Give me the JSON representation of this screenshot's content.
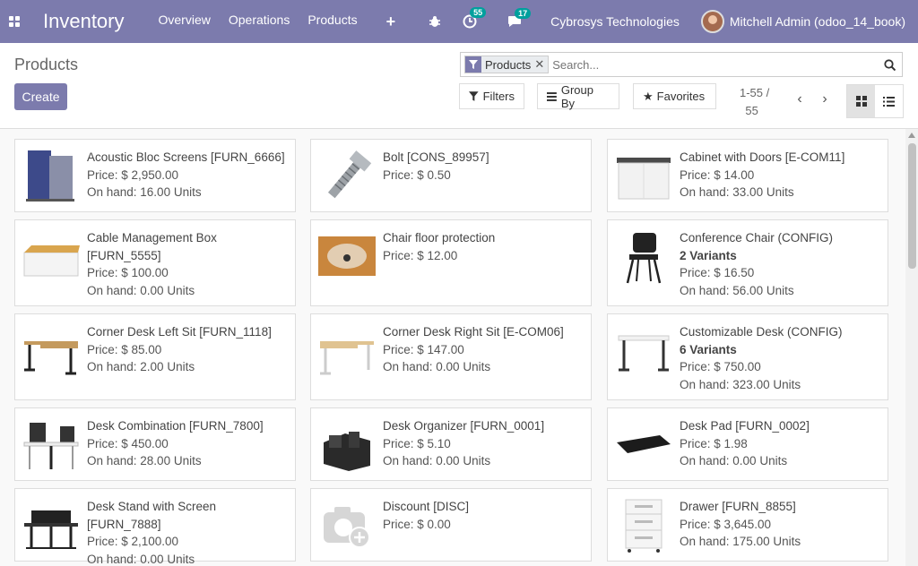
{
  "navbar": {
    "app_name": "Inventory",
    "menu": [
      "Overview",
      "Operations",
      "Products"
    ],
    "plus": "+",
    "activity_badge": "55",
    "messages_badge": "17",
    "company": "Cybrosys Technologies",
    "user": "Mitchell Admin (odoo_14_book)"
  },
  "control": {
    "breadcrumb": "Products",
    "create_label": "Create",
    "facet_label": "Products",
    "search_placeholder": "Search...",
    "filters_label": "Filters",
    "groupby_label": "Group By",
    "favorites_label": "Favorites",
    "pager_range": "1-55 /",
    "pager_total": "55"
  },
  "products": [
    {
      "name": "Acoustic Bloc Screens [FURN_6666]",
      "price": "Price: $ 2,950.00",
      "onhand": "On hand: 16.00 Units",
      "variants": "",
      "icon": "acoustic-screen"
    },
    {
      "name": "Bolt [CONS_89957]",
      "price": "Price: $ 0.50",
      "onhand": "",
      "variants": "",
      "icon": "bolt"
    },
    {
      "name": "Cabinet with Doors [E-COM11]",
      "price": "Price: $ 14.00",
      "onhand": "On hand: 33.00 Units",
      "variants": "",
      "icon": "cabinet"
    },
    {
      "name": "Cable Management Box [FURN_5555]",
      "price": "Price: $ 100.00",
      "onhand": "On hand: 0.00 Units",
      "variants": "",
      "icon": "cable-box"
    },
    {
      "name": "Chair floor protection",
      "price": "Price: $ 12.00",
      "onhand": "",
      "variants": "",
      "icon": "floor-mat"
    },
    {
      "name": "Conference Chair (CONFIG)",
      "price": "Price: $ 16.50",
      "onhand": "On hand: 56.00 Units",
      "variants": "2 Variants",
      "icon": "chair"
    },
    {
      "name": "Corner Desk Left Sit [FURN_1118]",
      "price": "Price: $ 85.00",
      "onhand": "On hand: 2.00 Units",
      "variants": "",
      "icon": "desk-left"
    },
    {
      "name": "Corner Desk Right Sit [E-COM06]",
      "price": "Price: $ 147.00",
      "onhand": "On hand: 0.00 Units",
      "variants": "",
      "icon": "desk-right"
    },
    {
      "name": "Customizable Desk (CONFIG)",
      "price": "Price: $ 750.00",
      "onhand": "On hand: 323.00 Units",
      "variants": "6 Variants",
      "icon": "desk-custom"
    },
    {
      "name": "Desk Combination [FURN_7800]",
      "price": "Price: $ 450.00",
      "onhand": "On hand: 28.00 Units",
      "variants": "",
      "icon": "desk-combo"
    },
    {
      "name": "Desk Organizer [FURN_0001]",
      "price": "Price: $ 5.10",
      "onhand": "On hand: 0.00 Units",
      "variants": "",
      "icon": "organizer"
    },
    {
      "name": "Desk Pad [FURN_0002]",
      "price": "Price: $ 1.98",
      "onhand": "On hand: 0.00 Units",
      "variants": "",
      "icon": "desk-pad"
    },
    {
      "name": "Desk Stand with Screen [FURN_7888]",
      "price": "Price: $ 2,100.00",
      "onhand": "On hand: 0.00 Units",
      "variants": "",
      "icon": "desk-stand"
    },
    {
      "name": "Discount [DISC]",
      "price": "Price: $ 0.00",
      "onhand": "",
      "variants": "",
      "icon": "camera-placeholder"
    },
    {
      "name": "Drawer [FURN_8855]",
      "price": "Price: $ 3,645.00",
      "onhand": "On hand: 175.00 Units",
      "variants": "",
      "icon": "drawer"
    }
  ],
  "colors": {
    "primary": "#7c7bad",
    "badge": "#00a09d"
  }
}
